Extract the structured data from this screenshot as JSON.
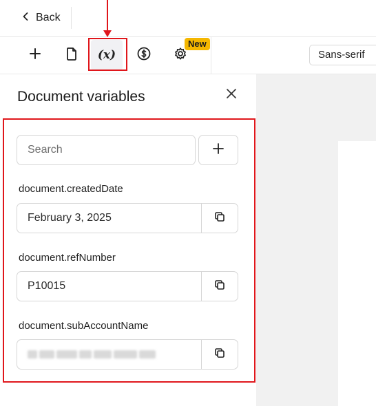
{
  "header": {
    "back_label": "Back"
  },
  "toolbar": {
    "variables_glyph": "(x)",
    "new_badge": "New",
    "font_family_value": "Sans-serif"
  },
  "panel": {
    "title": "Document variables",
    "search_placeholder": "Search",
    "variables": [
      {
        "name": "document.createdDate",
        "value": "February 3, 2025"
      },
      {
        "name": "document.refNumber",
        "value": "P10015"
      },
      {
        "name": "document.subAccountName",
        "value": ""
      }
    ]
  },
  "colors": {
    "annotation": "#e0161b",
    "badge": "#f5b700"
  },
  "icons": [
    "chevron-left-icon",
    "plus-icon",
    "document-icon",
    "variable-icon",
    "dollar-icon",
    "gear-icon",
    "close-icon",
    "copy-icon"
  ]
}
